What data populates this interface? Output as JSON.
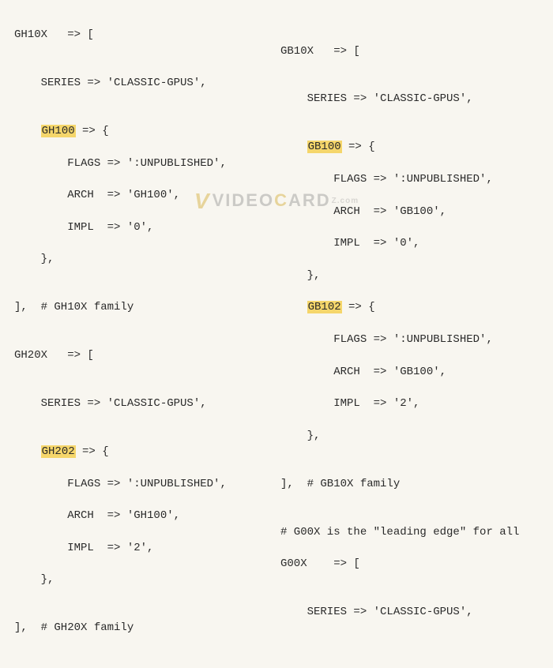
{
  "watermark": {
    "v": "V",
    "pre": "V",
    "mid1": "IDEO",
    "hl": "C",
    "mid2": "ARD",
    "ext": "Z.com"
  },
  "left": {
    "l01": "GH10X   => [",
    "l02": "",
    "l03": "    SERIES => 'CLASSIC-GPUS',",
    "l04": "",
    "l05a": "    ",
    "l05h": "GH100",
    "l05b": " => {",
    "l06": "        FLAGS => ':UNPUBLISHED',",
    "l07": "        ARCH  => 'GH100',",
    "l08": "        IMPL  => '0',",
    "l09": "    },",
    "l10": "",
    "l11": "],  # GH10X family",
    "l12": "",
    "l13": "GH20X   => [",
    "l14": "",
    "l15": "    SERIES => 'CLASSIC-GPUS',",
    "l16": "",
    "l17a": "    ",
    "l17h": "GH202",
    "l17b": " => {",
    "l18": "        FLAGS => ':UNPUBLISHED',",
    "l19": "        ARCH  => 'GH100',",
    "l20": "        IMPL  => '2',",
    "l21": "    },",
    "l22": "",
    "l23": "],  # GH20X family"
  },
  "right": {
    "l00": "",
    "l01": "GB10X   => [",
    "l02": "",
    "l03": "    SERIES => 'CLASSIC-GPUS',",
    "l04": "",
    "l05a": "    ",
    "l05h": "GB100",
    "l05b": " => {",
    "l06": "        FLAGS => ':UNPUBLISHED',",
    "l07": "        ARCH  => 'GB100',",
    "l08": "        IMPL  => '0',",
    "l09": "    },",
    "l10a": "    ",
    "l10h": "GB102",
    "l10b": " => {",
    "l11": "        FLAGS => ':UNPUBLISHED',",
    "l12": "        ARCH  => 'GB100',",
    "l13": "        IMPL  => '2',",
    "l14": "    },",
    "l15": "",
    "l16": "],  # GB10X family",
    "l17": "",
    "l18": "# G00X is the \"leading edge\" for all",
    "l19": "G00X    => [",
    "l20": "",
    "l21": "    SERIES => 'CLASSIC-GPUS',"
  }
}
